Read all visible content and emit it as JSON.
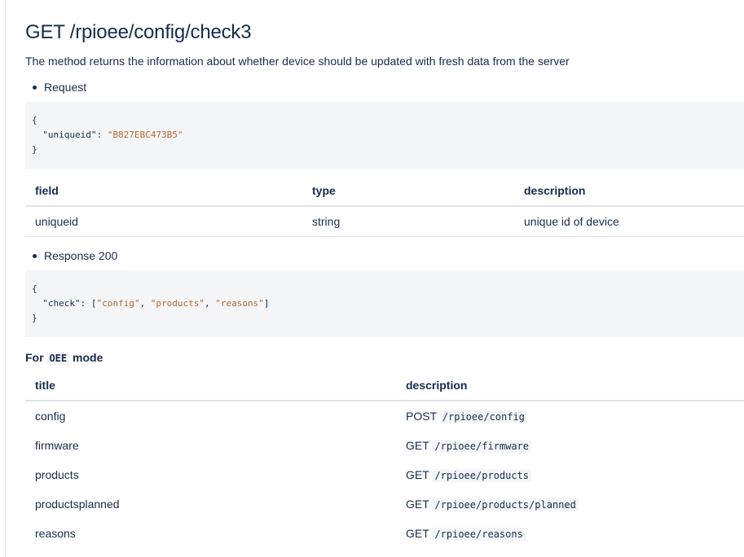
{
  "title": "GET /rpioee/config/check3",
  "description": "The method returns the information about whether device should be updated with fresh data from the server",
  "request": {
    "label": "Request",
    "code": {
      "open": "{",
      "key": "\"uniqueid\"",
      "sep": ": ",
      "value": "\"B827EBC473B5\"",
      "close": "}"
    }
  },
  "fields_table": {
    "headers": [
      "field",
      "type",
      "description"
    ],
    "rows": [
      [
        "uniqueid",
        "string",
        "unique id of device"
      ]
    ]
  },
  "response": {
    "label": "Response 200",
    "code": {
      "open": "{",
      "key": "\"check\"",
      "sep": ": [",
      "v1": "\"config\"",
      "c1": ", ",
      "v2": "\"products\"",
      "c2": ", ",
      "v3": "\"reasons\"",
      "end": "]",
      "close": "}"
    }
  },
  "mode": {
    "prefix": "For",
    "code": "OEE",
    "suffix": "mode"
  },
  "mode_table": {
    "headers": [
      "title",
      "description"
    ],
    "rows": [
      {
        "title": "config",
        "method": "POST",
        "path": "/rpioee/config"
      },
      {
        "title": "firmware",
        "method": "GET",
        "path": "/rpioee/firmware"
      },
      {
        "title": "products",
        "method": "GET",
        "path": "/rpioee/products"
      },
      {
        "title": "productsplanned",
        "method": "GET",
        "path": "/rpioee/products/planned"
      },
      {
        "title": "reasons",
        "method": "GET",
        "path": "/rpioee/reasons"
      }
    ]
  }
}
